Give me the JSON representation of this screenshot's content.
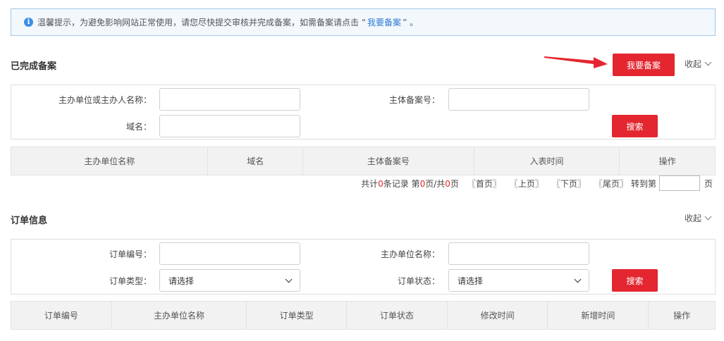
{
  "notice": {
    "icon": "info-icon",
    "text_before": "温馨提示，为避免影响网站正常使用，请您尽快提交审核并完成备案，如需备案请点击 “",
    "link": "我要备案",
    "text_after": "” 。"
  },
  "completed": {
    "title": "已完成备案",
    "register_button": "我要备案",
    "collapse": "收起",
    "fields": {
      "owner_label": "主办单位或主办人名称：",
      "owner_value": "",
      "record_no_label": "主体备案号：",
      "record_no_value": "",
      "domain_label": "域名：",
      "domain_value": ""
    },
    "search_button": "搜索",
    "columns": [
      "主办单位名称",
      "域名",
      "主体备案号",
      "入表时间",
      "操作"
    ],
    "pagination": {
      "prefix": "共计",
      "total": "0",
      "records_unit": "条记录 第",
      "page": "0",
      "page_sep": "页/共",
      "pages": "0",
      "pages_unit": "页",
      "first": "〖首页〗",
      "prev": "〖上页〗",
      "next": "〖下页〗",
      "last": "〖尾页〗",
      "goto": "转到第",
      "goto_value": "",
      "goto_unit": "页"
    }
  },
  "orders": {
    "title": "订单信息",
    "collapse": "收起",
    "fields": {
      "order_no_label": "订单编号：",
      "order_no_value": "",
      "owner_label": "主办单位名称：",
      "owner_value": "",
      "type_label": "订单类型：",
      "type_selected": "请选择",
      "status_label": "订单状态：",
      "status_selected": "请选择"
    },
    "search_button": "搜索",
    "columns": [
      "订单编号",
      "主办单位名称",
      "订单类型",
      "订单状态",
      "修改时间",
      "新增时间",
      "操作"
    ]
  },
  "colors": {
    "accent_red": "#e3262f",
    "link_blue": "#2a7ad2",
    "notice_bg": "#f3f8fd"
  }
}
